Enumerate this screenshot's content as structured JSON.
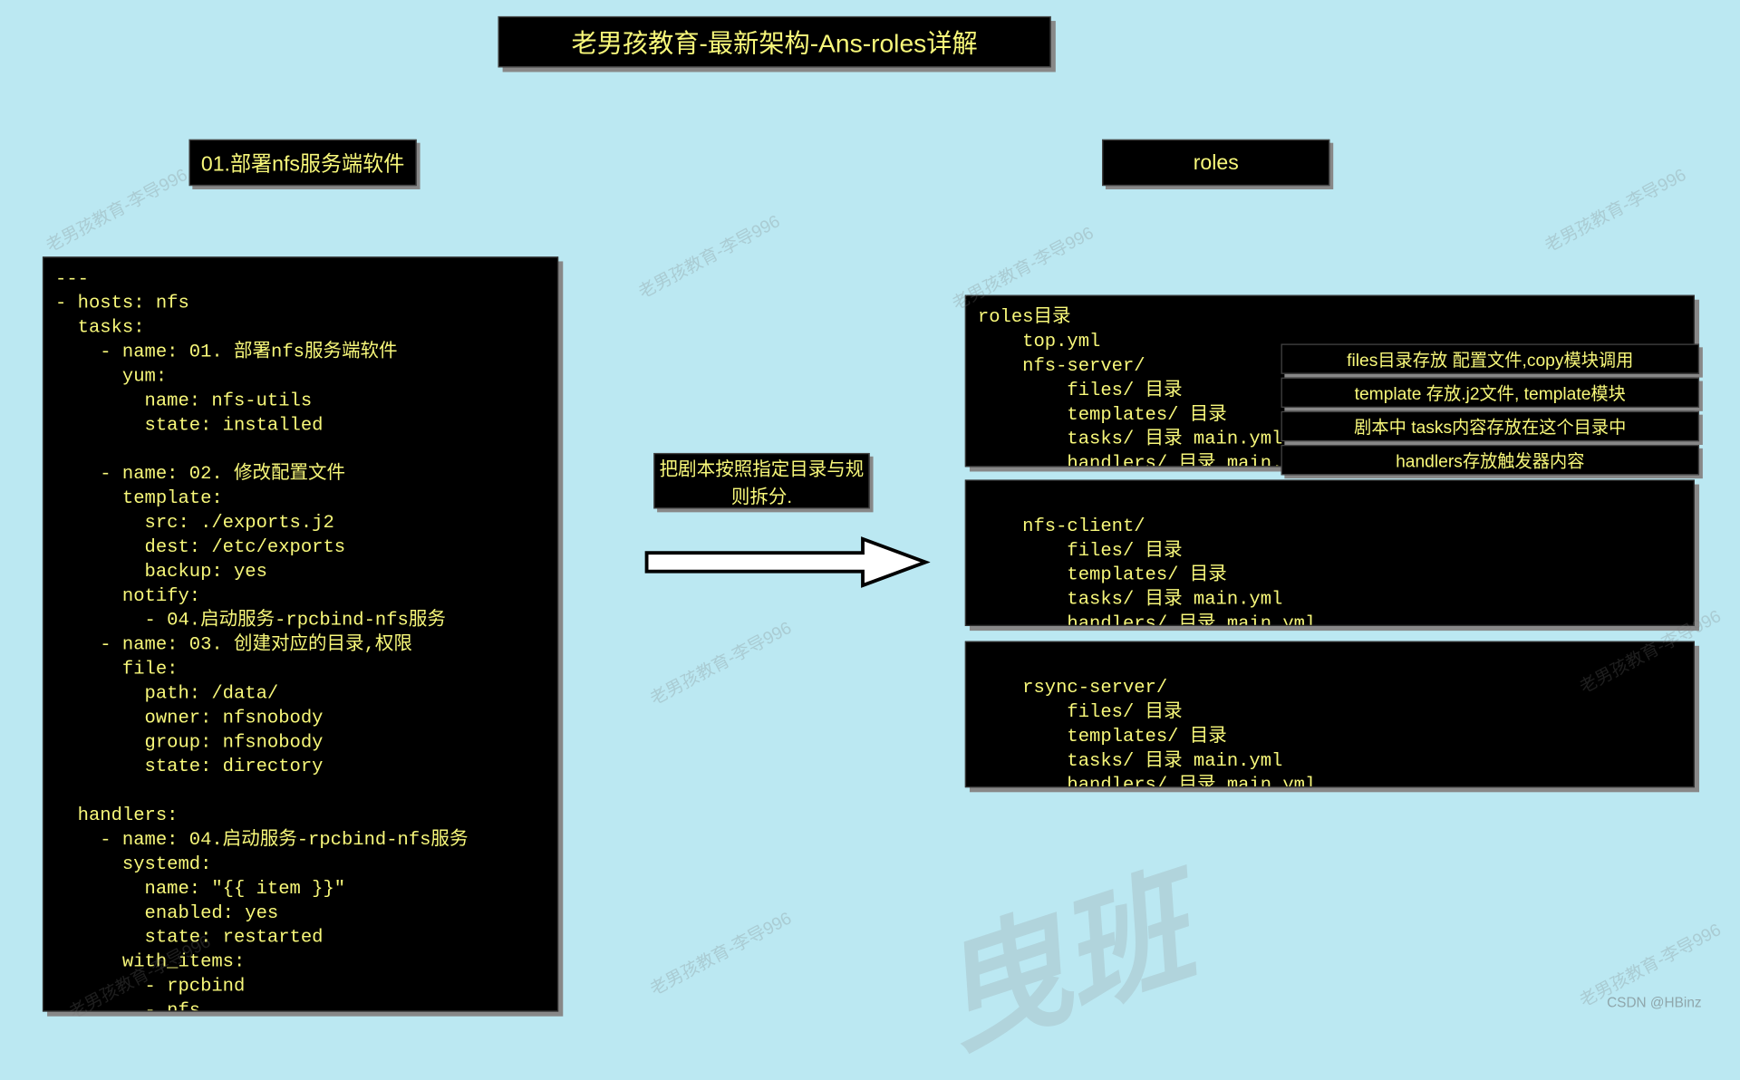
{
  "title": "老男孩教育-最新架构-Ans-roles详解",
  "labels": {
    "left": "01.部署nfs服务端软件",
    "right": "roles"
  },
  "left_code": "---\n- hosts: nfs\n  tasks:\n    - name: 01. 部署nfs服务端软件\n      yum:\n        name: nfs-utils\n        state: installed\n\n    - name: 02. 修改配置文件\n      template:\n        src: ./exports.j2\n        dest: /etc/exports\n        backup: yes\n      notify:\n        - 04.启动服务-rpcbind-nfs服务\n    - name: 03. 创建对应的目录,权限\n      file:\n        path: /data/\n        owner: nfsnobody\n        group: nfsnobody\n        state: directory\n\n  handlers:\n    - name: 04.启动服务-rpcbind-nfs服务\n      systemd:\n        name: \"{{ item }}\"\n        enabled: yes\n        state: restarted\n      with_items:\n        - rpcbind\n        - nfs",
  "mid": "把剧本按照指定目录与规则拆分.",
  "right_panels": {
    "r1": "roles目录\n    top.yml\n    nfs-server/\n        files/ 目录\n        templates/ 目录\n        tasks/ 目录 main.yml\n        handlers/ 目录 main.yml",
    "r2": "\n    nfs-client/\n        files/ 目录\n        templates/ 目录\n        tasks/ 目录 main.yml\n        handlers/ 目录 main.yml",
    "r3": "\n    rsync-server/\n        files/ 目录\n        templates/ 目录\n        tasks/ 目录 main.yml\n        handlers/ 目录 main.yml"
  },
  "annotations": {
    "a1": "files目录存放 配置文件,copy模块调用",
    "a2": "template  存放.j2文件, template模块",
    "a3": "剧本中 tasks内容存放在这个目录中",
    "a4": "handlers存放触发器内容"
  },
  "watermark_small": "老男孩教育-李导996",
  "watermark_big": "曳班",
  "credit": "CSDN @HBinz"
}
